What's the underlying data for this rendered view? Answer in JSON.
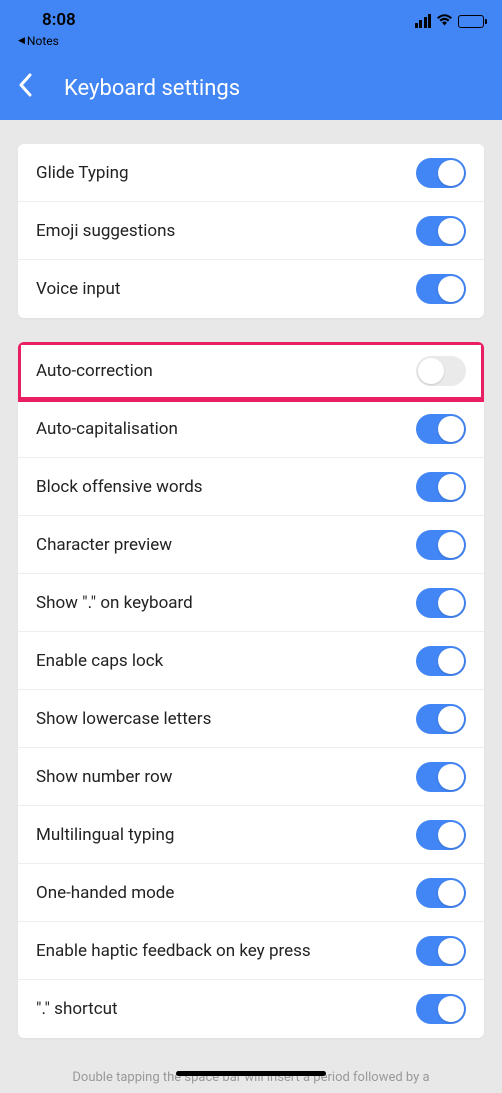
{
  "status": {
    "time": "8:08",
    "back_app": "Notes"
  },
  "header": {
    "title": "Keyboard settings"
  },
  "groups": [
    {
      "items": [
        {
          "key": "glide-typing",
          "label": "Glide Typing",
          "on": true,
          "highlight": false
        },
        {
          "key": "emoji-suggestions",
          "label": "Emoji suggestions",
          "on": true,
          "highlight": false
        },
        {
          "key": "voice-input",
          "label": "Voice input",
          "on": true,
          "highlight": false
        }
      ]
    },
    {
      "items": [
        {
          "key": "auto-correction",
          "label": "Auto-correction",
          "on": false,
          "highlight": true
        },
        {
          "key": "auto-capitalisation",
          "label": "Auto-capitalisation",
          "on": true,
          "highlight": false
        },
        {
          "key": "block-offensive-words",
          "label": "Block offensive words",
          "on": true,
          "highlight": false
        },
        {
          "key": "character-preview",
          "label": "Character preview",
          "on": true,
          "highlight": false
        },
        {
          "key": "show-period-on-keyboard",
          "label": "Show \".\" on keyboard",
          "on": true,
          "highlight": false
        },
        {
          "key": "enable-caps-lock",
          "label": "Enable caps lock",
          "on": true,
          "highlight": false
        },
        {
          "key": "show-lowercase-letters",
          "label": "Show lowercase letters",
          "on": true,
          "highlight": false
        },
        {
          "key": "show-number-row",
          "label": "Show number row",
          "on": true,
          "highlight": false
        },
        {
          "key": "multilingual-typing",
          "label": "Multilingual typing",
          "on": true,
          "highlight": false
        },
        {
          "key": "one-handed-mode",
          "label": "One-handed mode",
          "on": true,
          "highlight": false
        },
        {
          "key": "enable-haptic-feedback",
          "label": "Enable haptic feedback on key press",
          "on": true,
          "highlight": false
        },
        {
          "key": "period-shortcut",
          "label": "\".\" shortcut",
          "on": true,
          "highlight": false
        }
      ]
    }
  ],
  "footer_hint": "Double tapping the space bar will insert a period followed by a"
}
